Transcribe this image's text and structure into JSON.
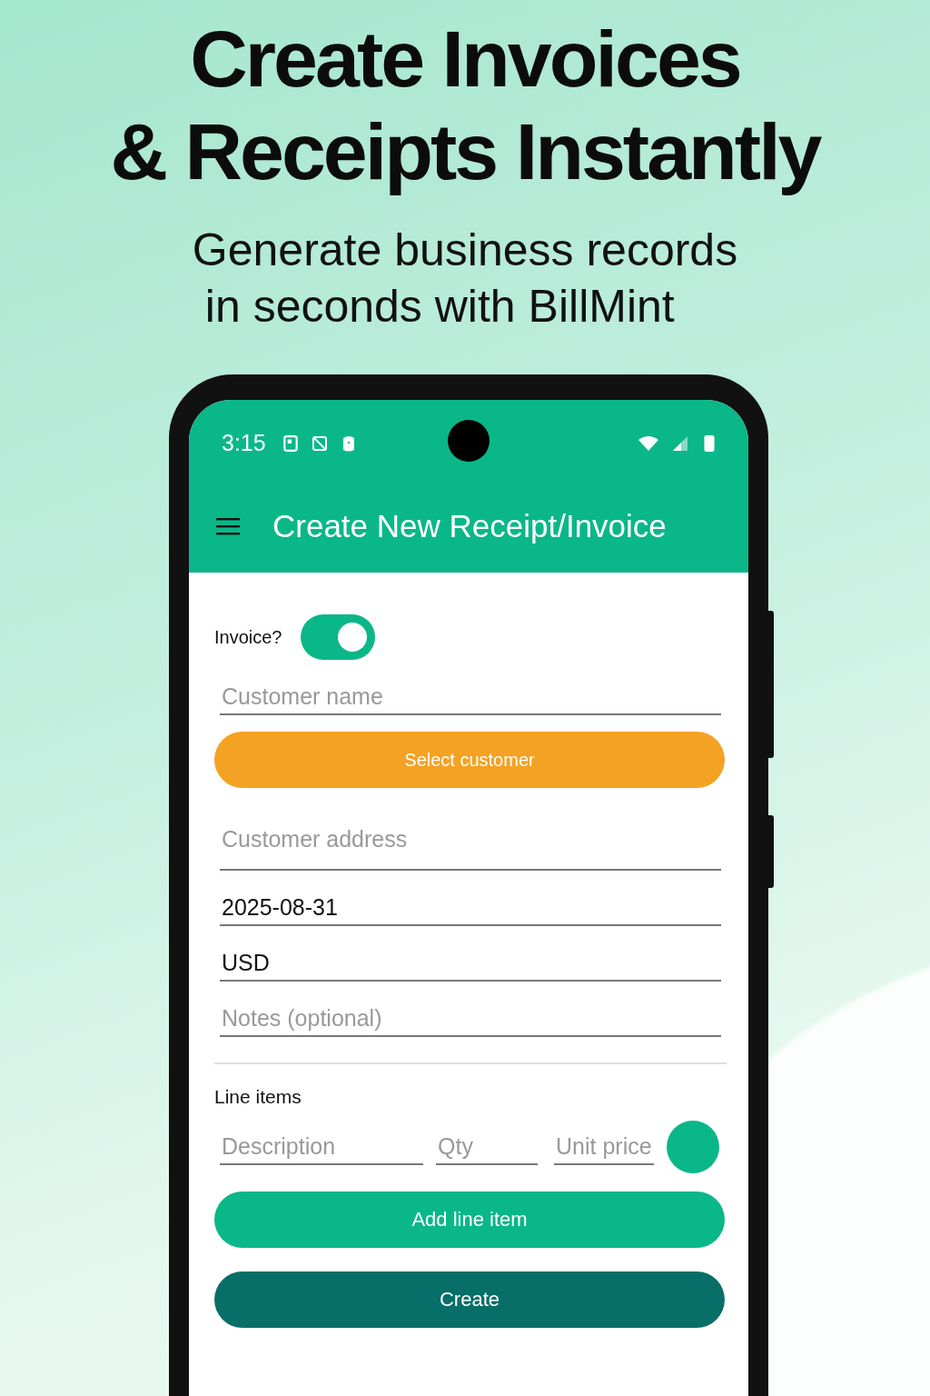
{
  "headline": [
    "Create Invoices",
    "& Receipts Instantly"
  ],
  "subtitle": [
    "Generate business records",
    "in seconds with BillMint"
  ],
  "status_bar": {
    "time": "3:15"
  },
  "app_bar": {
    "title": "Create New Receipt/Invoice"
  },
  "invoice_toggle": {
    "label": "Invoice?",
    "on": true
  },
  "form": [
    {
      "kind": "field",
      "placeholder": "Customer name"
    },
    {
      "kind": "button",
      "label": "Select customer"
    },
    {
      "kind": "field",
      "placeholder": "Customer address",
      "tall": true
    },
    {
      "kind": "field",
      "value": "2025-08-31"
    },
    {
      "kind": "field",
      "value": "USD"
    },
    {
      "kind": "field",
      "placeholder": "Notes (optional)"
    }
  ],
  "line_items": {
    "title": "Line items",
    "fields": [
      {
        "placeholder": "Description"
      },
      {
        "placeholder": "Qty"
      },
      {
        "placeholder": "Unit price"
      }
    ]
  },
  "buttons": [
    {
      "kind": "primary",
      "label": "Add line item"
    },
    {
      "kind": "dark",
      "label": "Create"
    }
  ]
}
